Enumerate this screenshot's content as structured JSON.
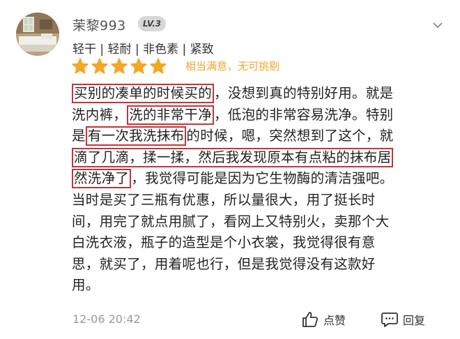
{
  "user": {
    "name": "茉黎993",
    "level": "LV.3"
  },
  "tags": "轻干 | 轻耐 | 非色素 | 紧致",
  "rating": {
    "stars": 5,
    "label": "相当满意，无可挑剔",
    "color": "#f5a623"
  },
  "review": {
    "lines": [
      [
        {
          "t": "买别的凑单的时候买的",
          "hl": true
        },
        {
          "t": "，没想到真的特别好用。就是"
        }
      ],
      [
        {
          "t": "洗内裤，"
        },
        {
          "t": "洗的非常干净",
          "hl": true
        },
        {
          "t": "，低泡的非常容易洗净。特别"
        }
      ],
      [
        {
          "t": "是"
        },
        {
          "t": "有一次我洗抹布",
          "hl": true
        },
        {
          "t": "的时候，嗯，突然想到了这个，就"
        }
      ],
      [
        {
          "t": "滴了几滴，揉一揉，然后我发现原本有点粘的抹布居",
          "hl": true
        }
      ],
      [
        {
          "t": "然洗净了",
          "hl": true
        },
        {
          "t": "，我觉得可能是因为它生物酶的清洁强吧。"
        }
      ],
      [
        {
          "t": "当时是买了三瓶有优惠，所以量很大，用了挺长时"
        }
      ],
      [
        {
          "t": "间，用完了就点用腻了，看网上又特别火，卖那个大"
        }
      ],
      [
        {
          "t": "白洗衣液，瓶子的造型是个小衣裳，我觉得很有意"
        }
      ],
      [
        {
          "t": "思，就买了，用着呢也行，但是我觉得没有这款好"
        }
      ],
      [
        {
          "t": "用。"
        }
      ]
    ]
  },
  "timestamp": "12-06 20:42",
  "actions": {
    "like_label": "点赞",
    "reply_label": "回复"
  },
  "colors": {
    "highlight_box": "#c8323a",
    "star": "#f5a623"
  }
}
